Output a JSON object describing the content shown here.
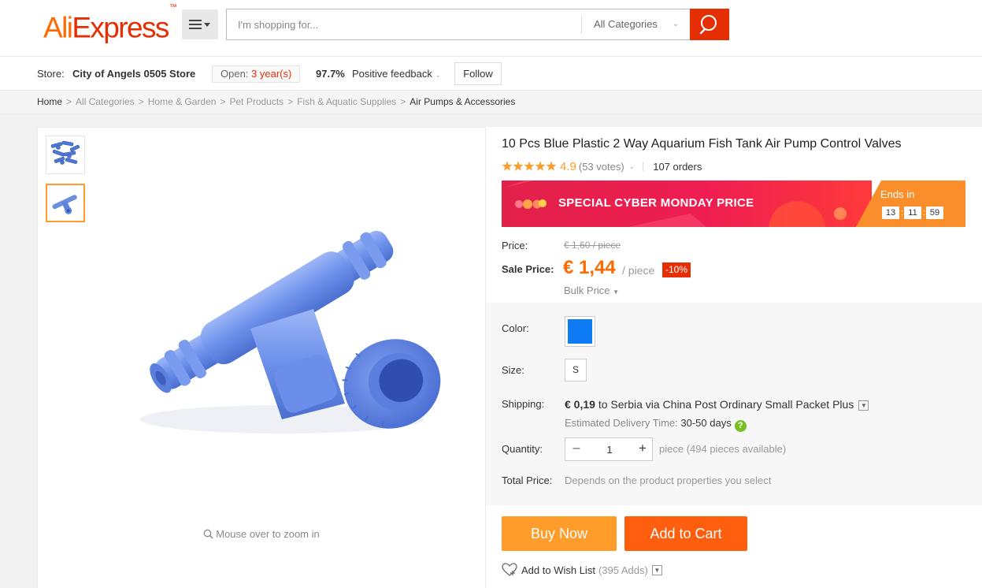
{
  "header": {
    "logo_ali": "Ali",
    "logo_express": "Express",
    "logo_tm": "™",
    "search_placeholder": "I'm shopping for...",
    "search_value": "",
    "category": "All Categories",
    "accent_color": "#e62e04"
  },
  "store": {
    "label": "Store:",
    "name": "City of Angels 0505 Store",
    "open_label": "Open:",
    "open_value": "3 year(s)",
    "feedback_pct": "97.7%",
    "feedback_label": "Positive feedback",
    "follow_label": "Follow"
  },
  "breadcrumb": [
    "Home",
    "All Categories",
    "Home & Garden",
    "Pet Products",
    "Fish & Aquatic Supplies",
    "Air Pumps & Accessories"
  ],
  "gallery": {
    "zoom_hint": "Mouse over to zoom in"
  },
  "product": {
    "title": "10 Pcs Blue Plastic 2 Way Aquarium Fish Tank Air Pump Control Valves",
    "rating": "4.9",
    "rating_stars": 5,
    "votes": "(53 votes)",
    "orders": "107 orders",
    "promo_text": "SPECIAL CYBER MONDAY PRICE",
    "ends_in_label": "Ends in",
    "countdown": [
      "13",
      "11",
      "59"
    ],
    "price_label": "Price:",
    "old_price": "€ 1,60 / piece",
    "sale_label": "Sale Price:",
    "sale_price": "€ 1,44",
    "per_piece": "/ piece",
    "discount": "-10%",
    "bulk_price": "Bulk Price",
    "color_label": "Color:",
    "color_value": "#0d7bf3",
    "size_label": "Size:",
    "size_value": "S",
    "shipping_label": "Shipping:",
    "shipping_cost": "€ 0,19",
    "shipping_to": "to",
    "shipping_dest": "Serbia via China Post Ordinary Small Packet Plus",
    "est_label": "Estimated Delivery Time:",
    "est_days": "30-50 days",
    "quantity_label": "Quantity:",
    "quantity": "1",
    "quantity_avail": "piece (494 pieces available)",
    "total_label": "Total Price:",
    "total_text": "Depends on the product properties you select",
    "buy_now": "Buy Now",
    "add_to_cart": "Add to Cart",
    "wishlist": "Add to Wish List",
    "wishlist_count": "(395 Adds)"
  }
}
